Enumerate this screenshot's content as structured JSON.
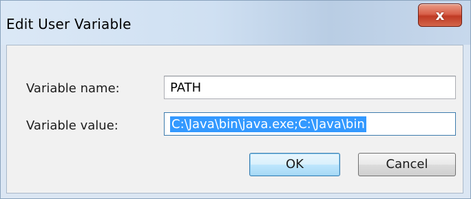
{
  "window": {
    "title": "Edit User Variable",
    "close_glyph": "x"
  },
  "form": {
    "name_label": "Variable name:",
    "name_value": "PATH",
    "value_label": "Variable value:",
    "value_value": "C:\\Java\\bin\\java.exe;C:\\Java\\bin"
  },
  "buttons": {
    "ok_label": "OK",
    "cancel_label": "Cancel"
  },
  "icons": {
    "close": "close-icon"
  },
  "colors": {
    "selection": "#3399ff",
    "close_button": "#c8452f",
    "default_button": "#bee6fd"
  }
}
